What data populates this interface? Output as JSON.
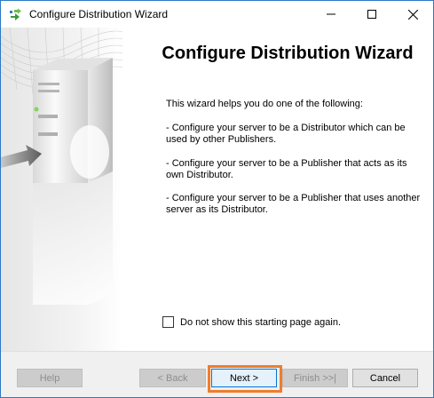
{
  "window": {
    "title": "Configure Distribution Wizard",
    "controls": {
      "minimize": "—",
      "maximize": "☐",
      "close": "✕"
    }
  },
  "main": {
    "heading": "Configure Distribution Wizard",
    "intro": "This wizard helps you do one of the following:",
    "options": [
      "- Configure your server to be a Distributor which can be used by other Publishers.",
      "- Configure your server to be a Publisher that acts as its own Distributor.",
      "- Configure your server to be a Publisher that uses another server as its Distributor."
    ],
    "checkbox": {
      "label": "Do not show this starting page again.",
      "checked": false
    }
  },
  "buttons": {
    "help": "Help",
    "back": "< Back",
    "next": "Next >",
    "finish": "Finish >>|",
    "cancel": "Cancel"
  },
  "colors": {
    "highlight": "#ee7d2f",
    "window_border": "#2b79c4"
  },
  "icons": {
    "app": "wizard-arrows-icon",
    "sidebar_art": "server-tower-illustration"
  }
}
